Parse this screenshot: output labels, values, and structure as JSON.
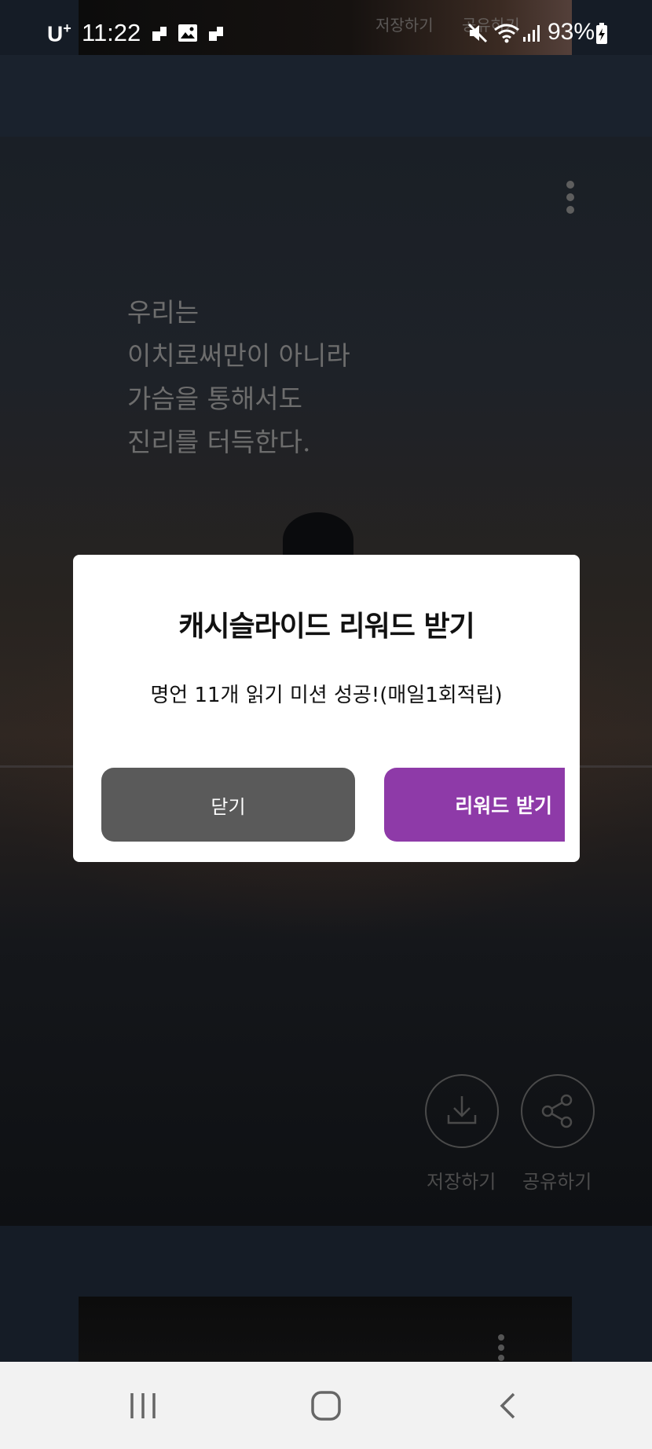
{
  "status_bar": {
    "carrier": "U",
    "carrier_sup": "+",
    "time": "11:22",
    "battery": "93%",
    "icons": [
      "notification-icon",
      "gallery-icon",
      "notification-icon",
      "mute-icon",
      "wifi-icon",
      "signal-icon",
      "battery-charging-icon"
    ]
  },
  "top_card": {
    "save_label": "저장하기",
    "share_label": "공유하기"
  },
  "quote_card": {
    "lines": [
      "우리는",
      "이치로써만이 아니라",
      "가슴을 통해서도",
      "진리를 터득한다."
    ],
    "save_label": "저장하기",
    "share_label": "공유하기",
    "icons": [
      "more-vert-icon",
      "download-icon",
      "share-icon"
    ]
  },
  "modal": {
    "title": "캐시슬라이드 리워드 받기",
    "message": "명언 11개 읽기 미션 성공!(매일1회적립)",
    "close_label": "닫기",
    "reward_label": "리워드 받기",
    "colors": {
      "close_bg": "#5a5a5a",
      "reward_bg": "#8e3aa8"
    }
  },
  "nav_bar": {
    "icons": [
      "recent-apps-icon",
      "home-icon",
      "back-icon"
    ]
  }
}
